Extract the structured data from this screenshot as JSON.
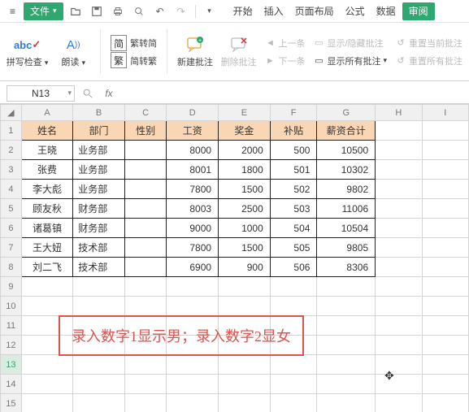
{
  "menubar": {
    "file_label": "文件",
    "tabs": [
      "开始",
      "插入",
      "页面布局",
      "公式",
      "数据",
      "审阅"
    ],
    "active_tab": 5
  },
  "ribbon": {
    "spellcheck": {
      "icon_text": "abc",
      "label": "拼写检查",
      "dd": "▾"
    },
    "read": {
      "label": "朗读",
      "dd": "▾"
    },
    "conv_group": {
      "icon": "简",
      "s2t": "繁转简",
      "t2s": "简转繁",
      "label": "繁"
    },
    "new_comment": "新建批注",
    "delete_comment": "删除批注",
    "prev": "上一条",
    "next": "下一条",
    "showhide": "显示/隐藏批注",
    "showall": "显示所有批注",
    "reset_cur": "重置当前批注",
    "reset_all": "重置所有批注"
  },
  "namebox": "N13",
  "fx": "fx",
  "columns": [
    "A",
    "B",
    "C",
    "D",
    "E",
    "F",
    "G",
    "H",
    "I"
  ],
  "headers": [
    "姓名",
    "部门",
    "性别",
    "工资",
    "奖金",
    "补贴",
    "薪资合计"
  ],
  "rows": [
    {
      "r": 2,
      "name": "王晓",
      "dept": "业务部",
      "sex": "",
      "salary": "8000",
      "bonus": "2000",
      "allow": "500",
      "total": "10500"
    },
    {
      "r": 3,
      "name": "张费",
      "dept": "业务部",
      "sex": "",
      "salary": "8001",
      "bonus": "1800",
      "allow": "501",
      "total": "10302"
    },
    {
      "r": 4,
      "name": "李大彪",
      "dept": "业务部",
      "sex": "",
      "salary": "7800",
      "bonus": "1500",
      "allow": "502",
      "total": "9802"
    },
    {
      "r": 5,
      "name": "顾友秋",
      "dept": "财务部",
      "sex": "",
      "salary": "8003",
      "bonus": "2500",
      "allow": "503",
      "total": "11006"
    },
    {
      "r": 6,
      "name": "诸葛镇",
      "dept": "财务部",
      "sex": "",
      "salary": "9000",
      "bonus": "1000",
      "allow": "504",
      "total": "10504"
    },
    {
      "r": 7,
      "name": "王大妞",
      "dept": "技术部",
      "sex": "",
      "salary": "7800",
      "bonus": "1500",
      "allow": "505",
      "total": "9805"
    },
    {
      "r": 8,
      "name": "刘二飞",
      "dept": "技术部",
      "sex": "",
      "salary": "6900",
      "bonus": "900",
      "allow": "506",
      "total": "8306"
    }
  ],
  "empty_rows": [
    9,
    10,
    11,
    12,
    13,
    14,
    15
  ],
  "active_row": 13,
  "annotation": "录入数字1显示男；录入数字2显女",
  "colors": {
    "accent": "#2ea86f",
    "header_fill": "#f9d6b4",
    "warn": "#d9534f"
  },
  "chart_data": {
    "type": "table",
    "columns": [
      "姓名",
      "部门",
      "性别",
      "工资",
      "奖金",
      "补贴",
      "薪资合计"
    ],
    "data": [
      [
        "王晓",
        "业务部",
        "",
        8000,
        2000,
        500,
        10500
      ],
      [
        "张费",
        "业务部",
        "",
        8001,
        1800,
        501,
        10302
      ],
      [
        "李大彪",
        "业务部",
        "",
        7800,
        1500,
        502,
        9802
      ],
      [
        "顾友秋",
        "财务部",
        "",
        8003,
        2500,
        503,
        11006
      ],
      [
        "诸葛镇",
        "财务部",
        "",
        9000,
        1000,
        504,
        10504
      ],
      [
        "王大妞",
        "技术部",
        "",
        7800,
        1500,
        505,
        9805
      ],
      [
        "刘二飞",
        "技术部",
        "",
        6900,
        900,
        506,
        8306
      ]
    ]
  }
}
